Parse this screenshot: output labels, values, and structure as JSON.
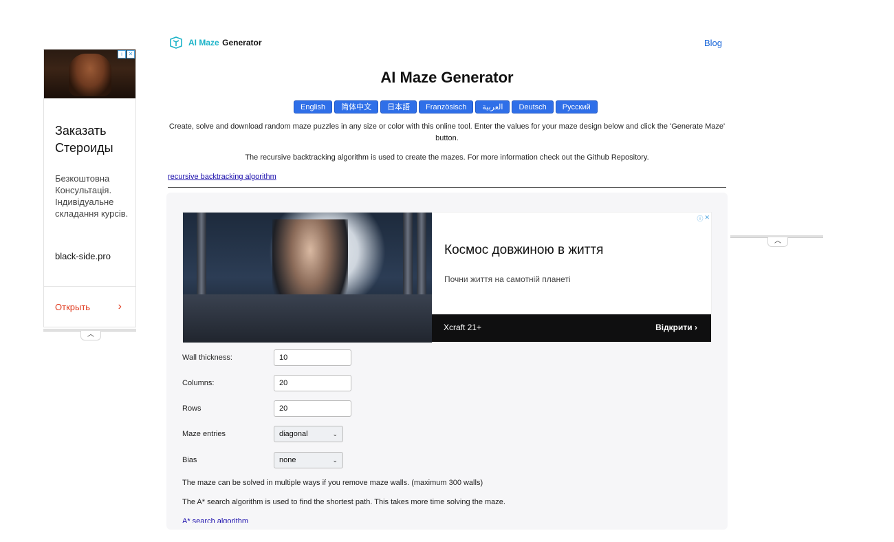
{
  "left_ad": {
    "headline": "Заказать Стероиды",
    "body": "Безкоштовна Консультація. Індивідуальне складання курсів.",
    "domain": "black-side.pro",
    "cta": "Открыть",
    "chevron": "›",
    "photo_icon": "bodybuilder-photo"
  },
  "header": {
    "logo_ai": "AI Maze",
    "logo_generator": "Generator",
    "blog": "Blog"
  },
  "page_title": "AI Maze Generator",
  "languages": [
    "English",
    "简体中文",
    "日本語",
    "Französisch",
    "العربية",
    "Deutsch",
    "Русский"
  ],
  "intro": {
    "line1": "Create, solve and download random maze puzzles in any size or color with this online tool. Enter the values for your maze design below and click the 'Generate Maze' button.",
    "line2": "The recursive backtracking algorithm is used to create the mazes. For more information check out the Github Repository.",
    "link": "recursive backtracking algorithm"
  },
  "banner_ad": {
    "headline": "Космос довжиною в життя",
    "sub": "Почни життя на самотній планеті",
    "brand": "Xcraft 21+",
    "cta": "Відкрити"
  },
  "form": {
    "wall_thickness": {
      "label": "Wall thickness:",
      "value": "10"
    },
    "columns": {
      "label": "Columns:",
      "value": "20"
    },
    "rows": {
      "label": "Rows",
      "value": "20"
    },
    "maze_entries": {
      "label": "Maze entries",
      "value": "diagonal"
    },
    "bias": {
      "label": "Bias",
      "value": "none"
    }
  },
  "notes": {
    "multiple_ways": "The maze can be solved in multiple ways if you remove maze walls. (maximum 300 walls)",
    "astar": "The A* search algorithm is used to find the shortest path. This takes more time solving the maze.",
    "astar_link": "A* search algorithm"
  },
  "colors": {
    "accent": "#2f6fe8",
    "logo_teal": "#1bb3c8",
    "link": "#1463d8",
    "ad_cta": "#e03a1e"
  }
}
